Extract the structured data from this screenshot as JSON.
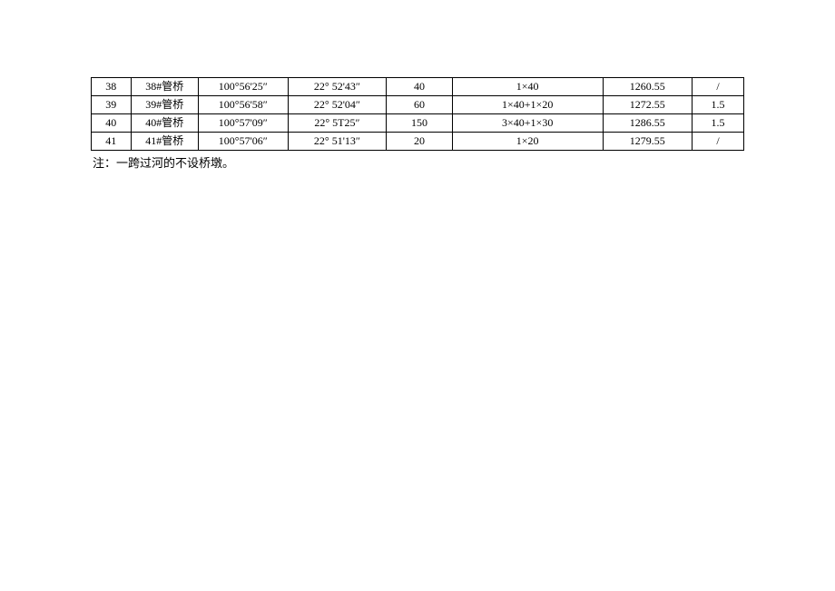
{
  "chart_data": {
    "type": "table",
    "rows": [
      {
        "num": "38",
        "name": "38#管桥",
        "coord1": "100°56'25″",
        "coord2": "22° 52'43″",
        "len": "40",
        "span": "1×40",
        "elev": "1260.55",
        "last": "/"
      },
      {
        "num": "39",
        "name": "39#管桥",
        "coord1": "100°56'58″",
        "coord2": "22° 52'04″",
        "len": "60",
        "span": "1×40+1×20",
        "elev": "1272.55",
        "last": "1.5"
      },
      {
        "num": "40",
        "name": "40#管桥",
        "coord1": "100°57'09″",
        "coord2": "22° 5T25″",
        "len": "150",
        "span": "3×40+1×30",
        "elev": "1286.55",
        "last": "1.5"
      },
      {
        "num": "41",
        "name": "41#管桥",
        "coord1": "100°57'06″",
        "coord2": "22° 51'13″",
        "len": "20",
        "span": "1×20",
        "elev": "1279.55",
        "last": "/"
      }
    ]
  },
  "note": {
    "label": "注：",
    "text": "一跨过河的不设桥墩。"
  }
}
